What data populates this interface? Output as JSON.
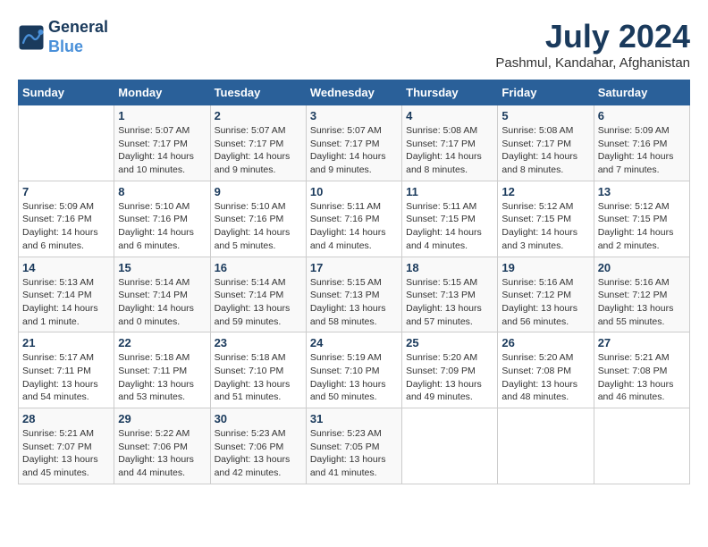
{
  "header": {
    "logo_line1": "General",
    "logo_line2": "Blue",
    "month_year": "July 2024",
    "location": "Pashmul, Kandahar, Afghanistan"
  },
  "days_of_week": [
    "Sunday",
    "Monday",
    "Tuesday",
    "Wednesday",
    "Thursday",
    "Friday",
    "Saturday"
  ],
  "weeks": [
    [
      {
        "num": "",
        "info": ""
      },
      {
        "num": "1",
        "info": "Sunrise: 5:07 AM\nSunset: 7:17 PM\nDaylight: 14 hours\nand 10 minutes."
      },
      {
        "num": "2",
        "info": "Sunrise: 5:07 AM\nSunset: 7:17 PM\nDaylight: 14 hours\nand 9 minutes."
      },
      {
        "num": "3",
        "info": "Sunrise: 5:07 AM\nSunset: 7:17 PM\nDaylight: 14 hours\nand 9 minutes."
      },
      {
        "num": "4",
        "info": "Sunrise: 5:08 AM\nSunset: 7:17 PM\nDaylight: 14 hours\nand 8 minutes."
      },
      {
        "num": "5",
        "info": "Sunrise: 5:08 AM\nSunset: 7:17 PM\nDaylight: 14 hours\nand 8 minutes."
      },
      {
        "num": "6",
        "info": "Sunrise: 5:09 AM\nSunset: 7:16 PM\nDaylight: 14 hours\nand 7 minutes."
      }
    ],
    [
      {
        "num": "7",
        "info": "Sunrise: 5:09 AM\nSunset: 7:16 PM\nDaylight: 14 hours\nand 6 minutes."
      },
      {
        "num": "8",
        "info": "Sunrise: 5:10 AM\nSunset: 7:16 PM\nDaylight: 14 hours\nand 6 minutes."
      },
      {
        "num": "9",
        "info": "Sunrise: 5:10 AM\nSunset: 7:16 PM\nDaylight: 14 hours\nand 5 minutes."
      },
      {
        "num": "10",
        "info": "Sunrise: 5:11 AM\nSunset: 7:16 PM\nDaylight: 14 hours\nand 4 minutes."
      },
      {
        "num": "11",
        "info": "Sunrise: 5:11 AM\nSunset: 7:15 PM\nDaylight: 14 hours\nand 4 minutes."
      },
      {
        "num": "12",
        "info": "Sunrise: 5:12 AM\nSunset: 7:15 PM\nDaylight: 14 hours\nand 3 minutes."
      },
      {
        "num": "13",
        "info": "Sunrise: 5:12 AM\nSunset: 7:15 PM\nDaylight: 14 hours\nand 2 minutes."
      }
    ],
    [
      {
        "num": "14",
        "info": "Sunrise: 5:13 AM\nSunset: 7:14 PM\nDaylight: 14 hours\nand 1 minute."
      },
      {
        "num": "15",
        "info": "Sunrise: 5:14 AM\nSunset: 7:14 PM\nDaylight: 14 hours\nand 0 minutes."
      },
      {
        "num": "16",
        "info": "Sunrise: 5:14 AM\nSunset: 7:14 PM\nDaylight: 13 hours\nand 59 minutes."
      },
      {
        "num": "17",
        "info": "Sunrise: 5:15 AM\nSunset: 7:13 PM\nDaylight: 13 hours\nand 58 minutes."
      },
      {
        "num": "18",
        "info": "Sunrise: 5:15 AM\nSunset: 7:13 PM\nDaylight: 13 hours\nand 57 minutes."
      },
      {
        "num": "19",
        "info": "Sunrise: 5:16 AM\nSunset: 7:12 PM\nDaylight: 13 hours\nand 56 minutes."
      },
      {
        "num": "20",
        "info": "Sunrise: 5:16 AM\nSunset: 7:12 PM\nDaylight: 13 hours\nand 55 minutes."
      }
    ],
    [
      {
        "num": "21",
        "info": "Sunrise: 5:17 AM\nSunset: 7:11 PM\nDaylight: 13 hours\nand 54 minutes."
      },
      {
        "num": "22",
        "info": "Sunrise: 5:18 AM\nSunset: 7:11 PM\nDaylight: 13 hours\nand 53 minutes."
      },
      {
        "num": "23",
        "info": "Sunrise: 5:18 AM\nSunset: 7:10 PM\nDaylight: 13 hours\nand 51 minutes."
      },
      {
        "num": "24",
        "info": "Sunrise: 5:19 AM\nSunset: 7:10 PM\nDaylight: 13 hours\nand 50 minutes."
      },
      {
        "num": "25",
        "info": "Sunrise: 5:20 AM\nSunset: 7:09 PM\nDaylight: 13 hours\nand 49 minutes."
      },
      {
        "num": "26",
        "info": "Sunrise: 5:20 AM\nSunset: 7:08 PM\nDaylight: 13 hours\nand 48 minutes."
      },
      {
        "num": "27",
        "info": "Sunrise: 5:21 AM\nSunset: 7:08 PM\nDaylight: 13 hours\nand 46 minutes."
      }
    ],
    [
      {
        "num": "28",
        "info": "Sunrise: 5:21 AM\nSunset: 7:07 PM\nDaylight: 13 hours\nand 45 minutes."
      },
      {
        "num": "29",
        "info": "Sunrise: 5:22 AM\nSunset: 7:06 PM\nDaylight: 13 hours\nand 44 minutes."
      },
      {
        "num": "30",
        "info": "Sunrise: 5:23 AM\nSunset: 7:06 PM\nDaylight: 13 hours\nand 42 minutes."
      },
      {
        "num": "31",
        "info": "Sunrise: 5:23 AM\nSunset: 7:05 PM\nDaylight: 13 hours\nand 41 minutes."
      },
      {
        "num": "",
        "info": ""
      },
      {
        "num": "",
        "info": ""
      },
      {
        "num": "",
        "info": ""
      }
    ]
  ]
}
